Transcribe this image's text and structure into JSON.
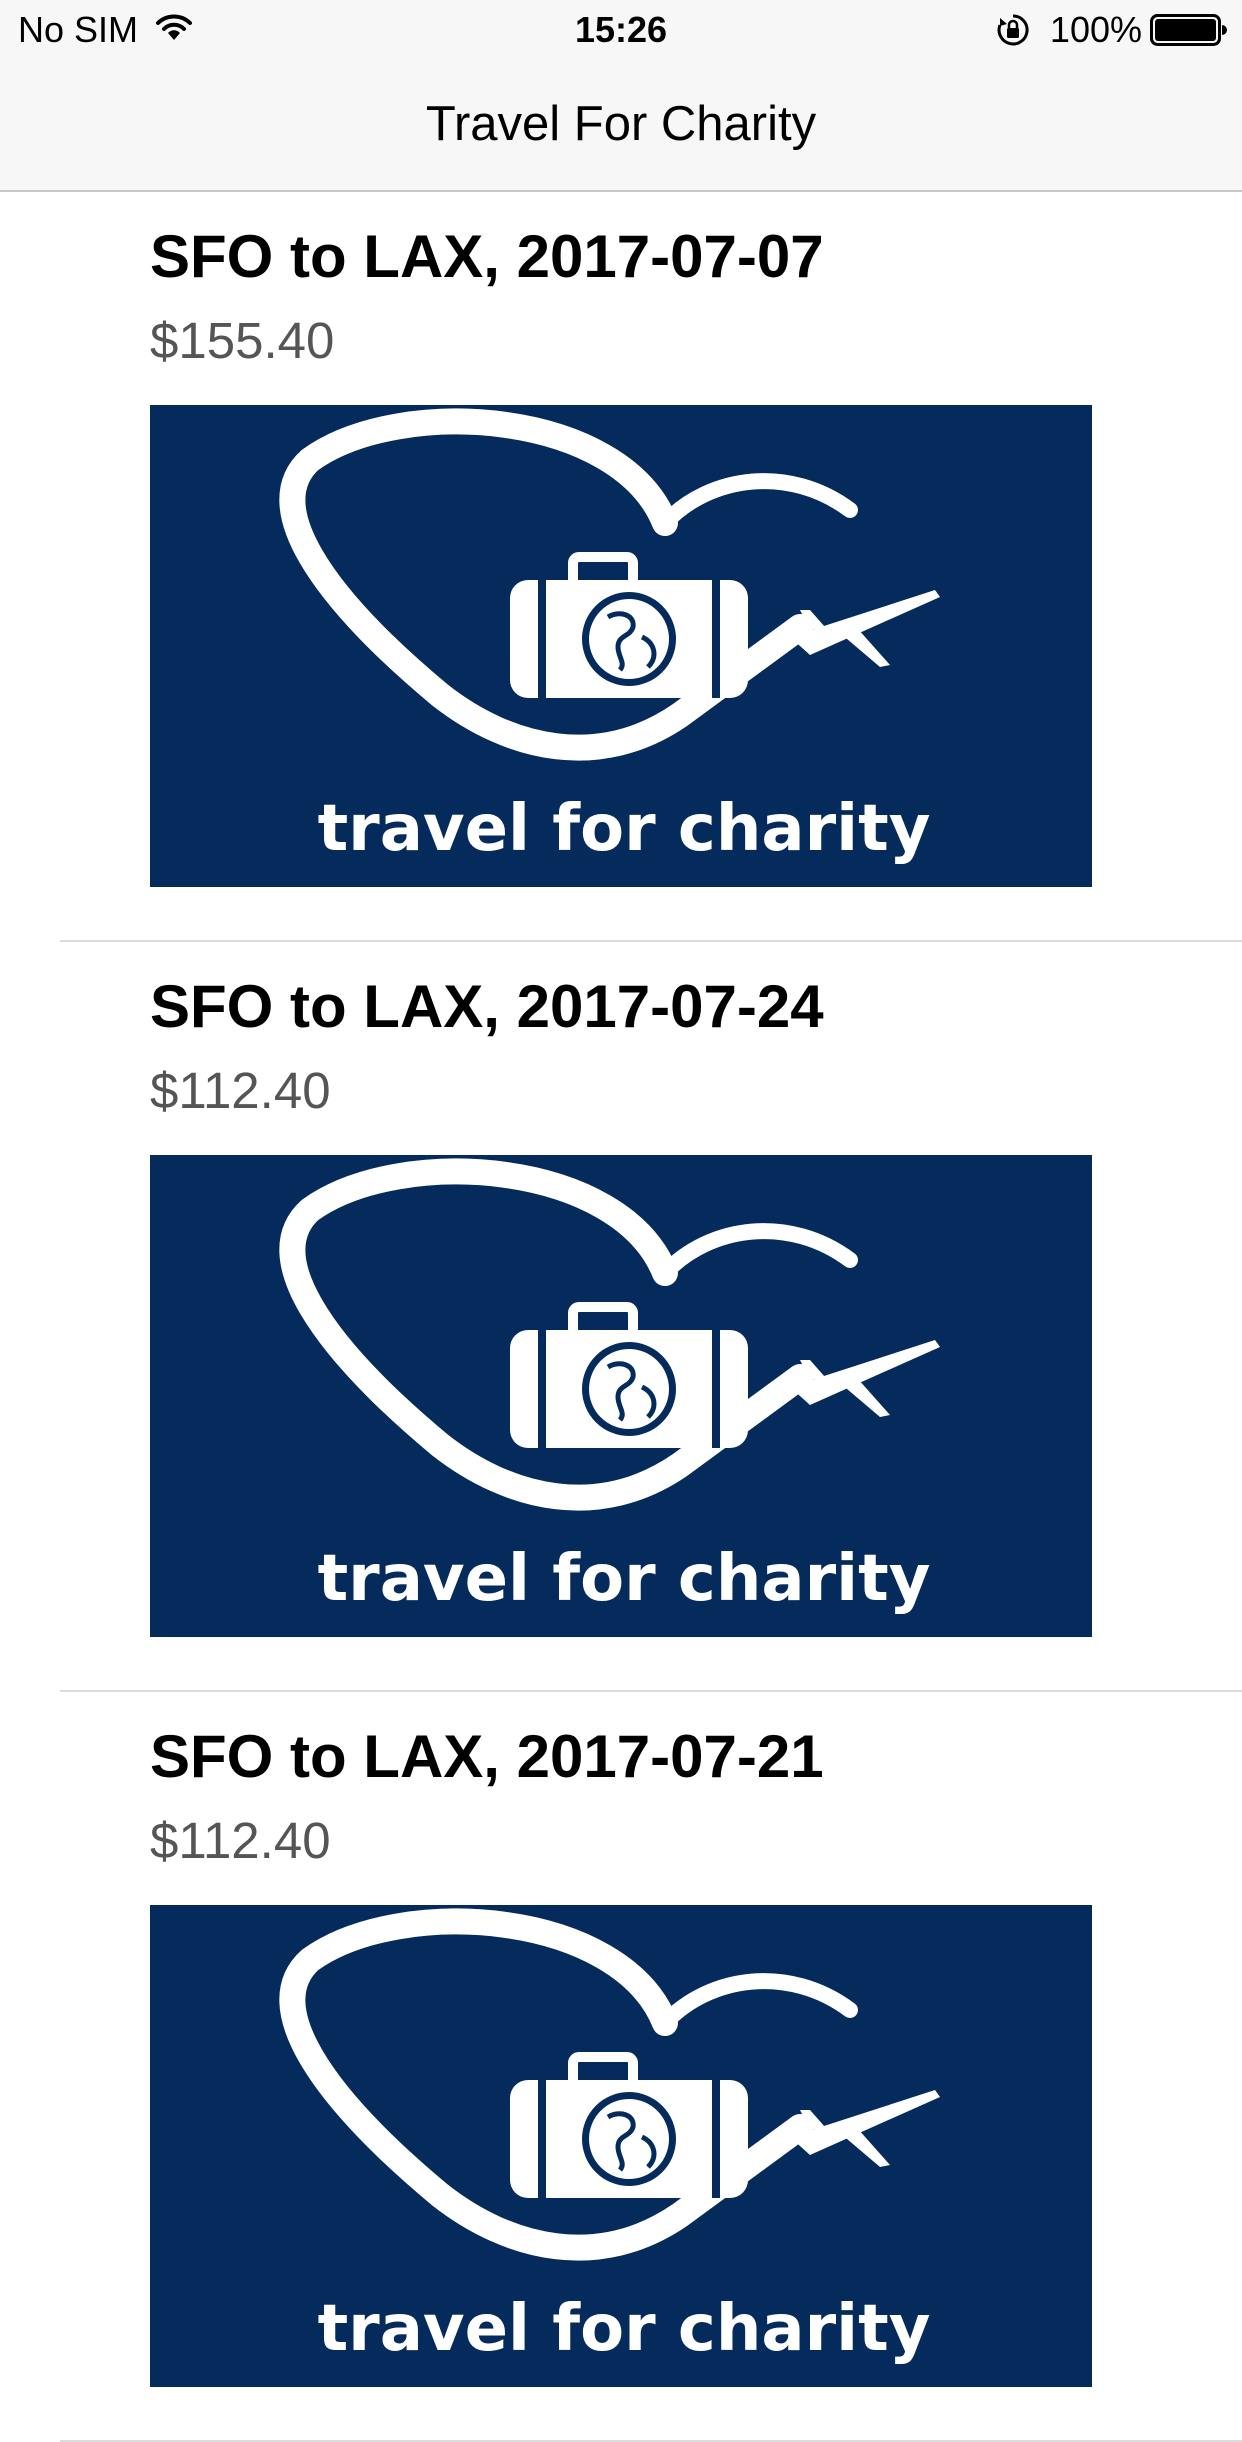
{
  "status_bar": {
    "carrier": "No SIM",
    "time": "15:26",
    "battery_percent": "100%",
    "icons": [
      "wifi-icon",
      "orientation-lock-icon",
      "battery-icon"
    ]
  },
  "nav_bar": {
    "title": "Travel For Charity"
  },
  "trips": [
    {
      "title": "SFO to LAX, 2017-07-07",
      "price": "$155.40",
      "image_text": "travel for charity"
    },
    {
      "title": "SFO to LAX, 2017-07-24",
      "price": "$112.40",
      "image_text": "travel for charity"
    },
    {
      "title": "SFO to LAX, 2017-07-21",
      "price": "$112.40",
      "image_text": "travel for charity"
    }
  ],
  "colors": {
    "banner_background": "#052b5c",
    "bar_background": "#f7f7f7",
    "price_text": "#555555"
  }
}
